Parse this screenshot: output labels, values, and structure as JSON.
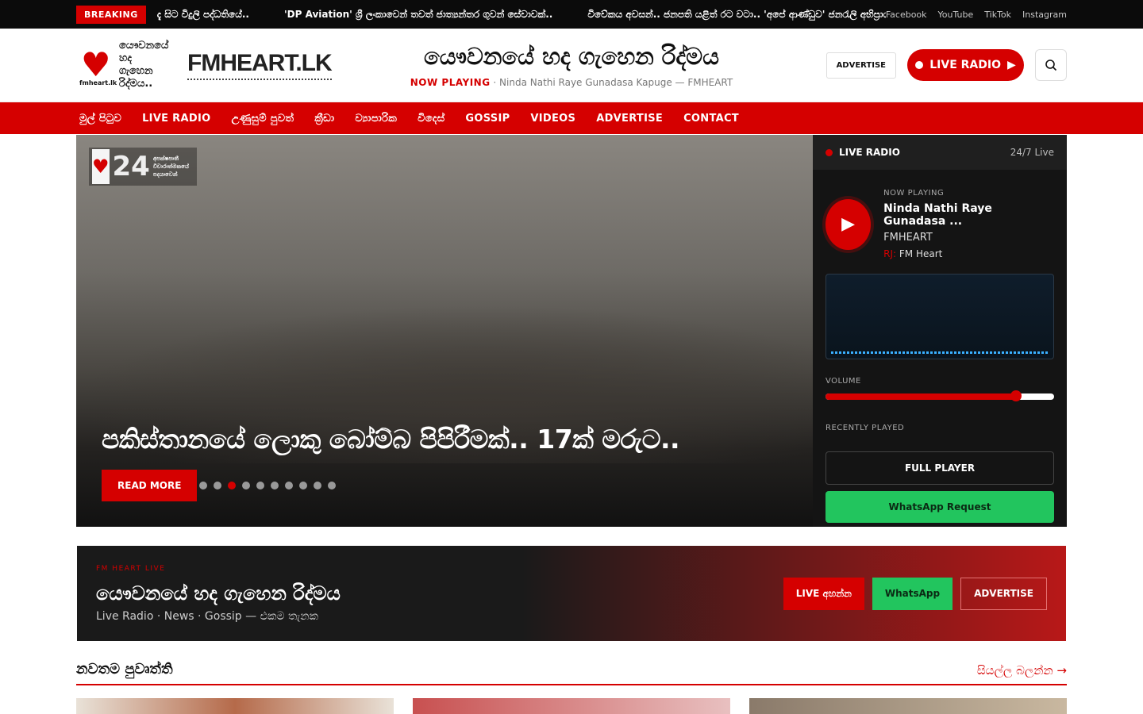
{
  "topbar": {
    "breaking_label": "BREAKING",
    "ticker": [
      "දැ සිට විදුලි පද්ධතියේ..",
      "'DP Aviation' ශ්‍රී ලංකාවෙන් තවත් ජාත්‍යන්තර ගුවන් සේවාවක්..",
      "විවේකය අවසන්.. ජනපති යළිත් රට වටා.. 'අපේ ආණ්ඩුව' ජනරැලි අභිප්‍රාය මතුව"
    ],
    "social": [
      "Facebook",
      "YouTube",
      "TikTok",
      "Instagram"
    ]
  },
  "header": {
    "logo_tag": "fmheart.lk",
    "logo_sinhala": "යෞවනයේ හද ගැහෙන රිද්මය..",
    "logo_text": "FMHEART.LK",
    "tagline": "යෞවනයේ හද ගැහෙන රිද්මය",
    "now_playing_label": "NOW PLAYING",
    "now_playing_text": "Ninda Nathi Raye Gunadasa Kapuge — FMHEART",
    "advertise_label": "ADVERTISE",
    "live_radio_label": "LIVE RADIO"
  },
  "nav": [
    "මුල් පිටුව",
    "LIVE RADIO",
    "උණුසුම් පුවත්",
    "ක්‍රීඩා",
    "ව්‍යාපාරික",
    "විදෙස්",
    "GOSSIP",
    "VIDEOS",
    "ADVERTISE",
    "CONTACT"
  ],
  "hero": {
    "badge_number": "24",
    "badge_text": "අපක්ෂපාතී විචාරාත්මකයේ පදයාවෙන්",
    "title": "පකිස්තානයේ ලොකු බෝම්බ පිපිරීමක්.. 17ක් මරුට..",
    "read_more": "READ MORE",
    "slide_count": 10,
    "active_slide": 3
  },
  "radio": {
    "header": "LIVE RADIO",
    "status": "24/7 Live",
    "now_playing_label": "NOW PLAYING",
    "song": "Ninda Nathi Raye Gunadasa ...",
    "artist": "FMHEART",
    "rj_label": "RJ:",
    "rj_name": "FM Heart",
    "volume_label": "VOLUME",
    "volume_level": 0.835,
    "recently_played_label": "RECENTLY PLAYED",
    "full_player": "FULL PLAYER",
    "whatsapp_request": "WhatsApp Request"
  },
  "promo": {
    "small": "FM HEART LIVE",
    "title": "යෞවනයේ හද ගැහෙන රිද්මය",
    "subtitle": "Live Radio · News · Gossip — එකම තැනක",
    "btn_live": "LIVE අහන්න",
    "btn_whatsapp": "WhatsApp",
    "btn_advertise": "ADVERTISE"
  },
  "latest": {
    "title": "නවතම පුවෘත්ති",
    "view_all": "සියල්ල බලන්න →"
  },
  "colors": {
    "accent": "#d50000",
    "dark": "#141414",
    "whatsapp": "#22c55e"
  }
}
